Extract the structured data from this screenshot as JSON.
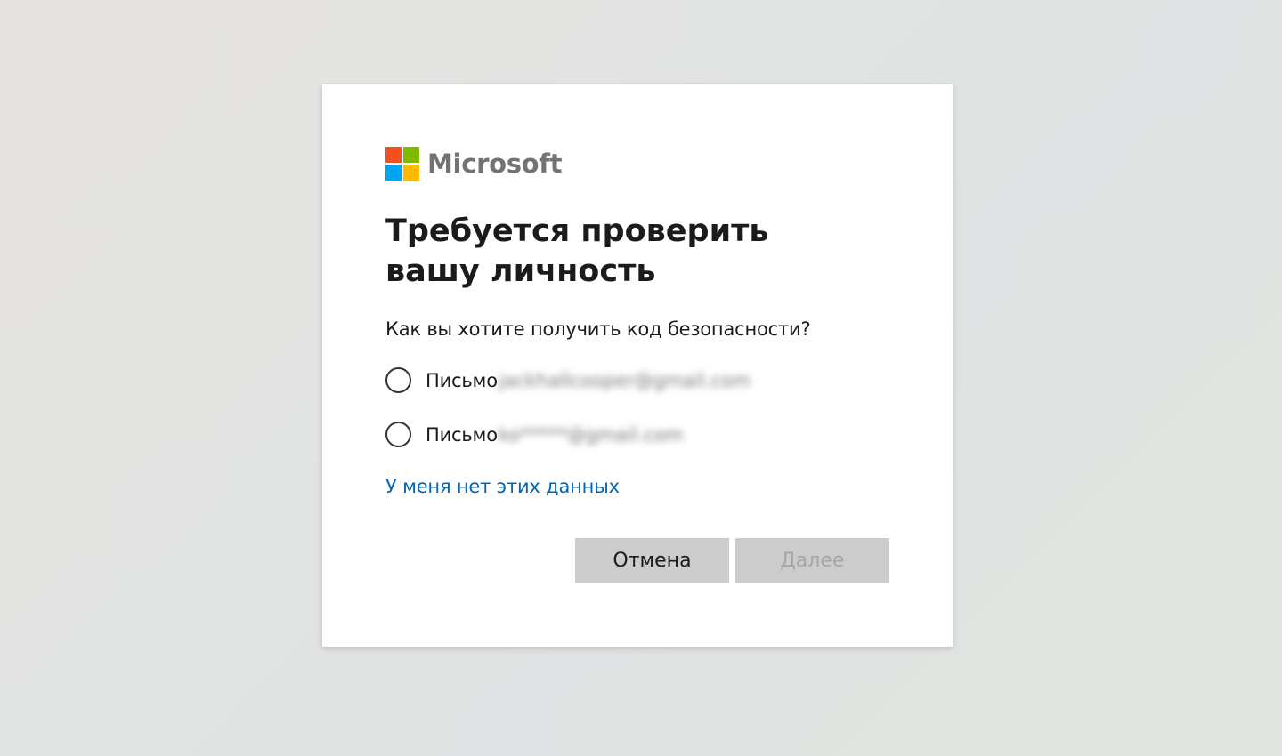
{
  "brand": {
    "name": "Microsoft",
    "logo_colors": [
      "#f25022",
      "#7fba00",
      "#00a4ef",
      "#ffb900"
    ]
  },
  "dialog": {
    "title": "Требуется проверить вашу личность",
    "prompt": "Как вы хотите получить код безопасности?",
    "options": [
      {
        "label": "Письмо",
        "value_blurred": "jackhallcooper@gmail.com",
        "selected": false
      },
      {
        "label": "Письмо",
        "value_blurred": "ko*****@gmail.com",
        "selected": false
      }
    ],
    "no_data_link": "У меня нет этих данных",
    "cancel_label": "Отмена",
    "next_label": "Далее",
    "next_disabled": true
  },
  "colors": {
    "link": "#0067b8",
    "button_bg": "#cccccc"
  }
}
